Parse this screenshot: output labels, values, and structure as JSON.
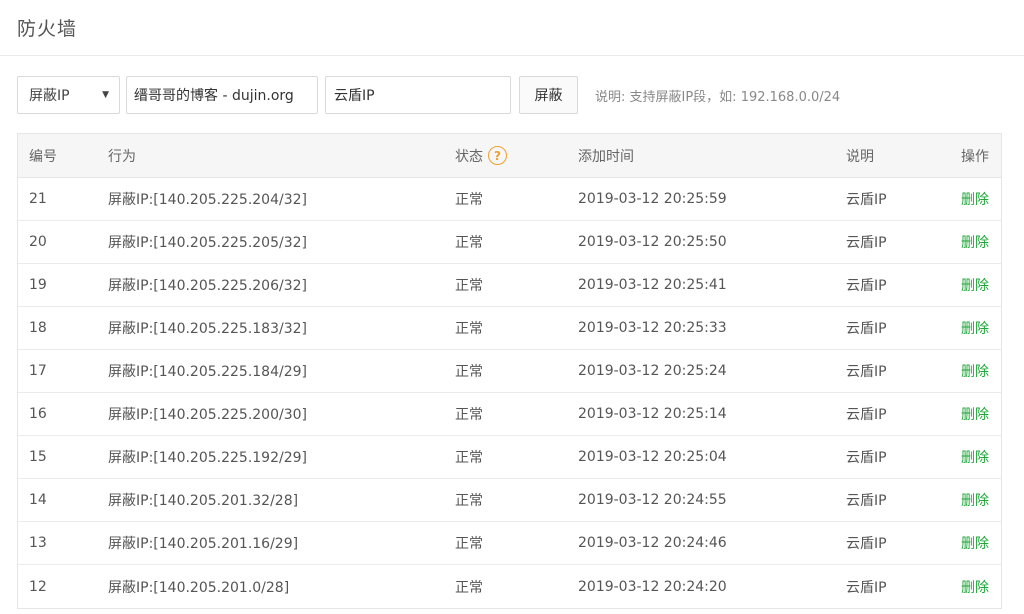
{
  "page": {
    "title": "防火墙"
  },
  "toolbar": {
    "select_value": "屏蔽IP",
    "site_value": "缙哥哥的博客 - dujin.org",
    "desc_value": "云盾IP",
    "block_label": "屏蔽",
    "hint": "说明: 支持屏蔽IP段，如: 192.168.0.0/24"
  },
  "table": {
    "headers": {
      "id": "编号",
      "action": "行为",
      "status": "状态",
      "time": "添加时间",
      "note": "说明",
      "op": "操作"
    },
    "rows": [
      {
        "id": "21",
        "action": "屏蔽IP:[140.205.225.204/32]",
        "status": "正常",
        "time": "2019-03-12 20:25:59",
        "note": "云盾IP",
        "op": "删除"
      },
      {
        "id": "20",
        "action": "屏蔽IP:[140.205.225.205/32]",
        "status": "正常",
        "time": "2019-03-12 20:25:50",
        "note": "云盾IP",
        "op": "删除"
      },
      {
        "id": "19",
        "action": "屏蔽IP:[140.205.225.206/32]",
        "status": "正常",
        "time": "2019-03-12 20:25:41",
        "note": "云盾IP",
        "op": "删除"
      },
      {
        "id": "18",
        "action": "屏蔽IP:[140.205.225.183/32]",
        "status": "正常",
        "time": "2019-03-12 20:25:33",
        "note": "云盾IP",
        "op": "删除"
      },
      {
        "id": "17",
        "action": "屏蔽IP:[140.205.225.184/29]",
        "status": "正常",
        "time": "2019-03-12 20:25:24",
        "note": "云盾IP",
        "op": "删除"
      },
      {
        "id": "16",
        "action": "屏蔽IP:[140.205.225.200/30]",
        "status": "正常",
        "time": "2019-03-12 20:25:14",
        "note": "云盾IP",
        "op": "删除"
      },
      {
        "id": "15",
        "action": "屏蔽IP:[140.205.225.192/29]",
        "status": "正常",
        "time": "2019-03-12 20:25:04",
        "note": "云盾IP",
        "op": "删除"
      },
      {
        "id": "14",
        "action": "屏蔽IP:[140.205.201.32/28]",
        "status": "正常",
        "time": "2019-03-12 20:24:55",
        "note": "云盾IP",
        "op": "删除"
      },
      {
        "id": "13",
        "action": "屏蔽IP:[140.205.201.16/29]",
        "status": "正常",
        "time": "2019-03-12 20:24:46",
        "note": "云盾IP",
        "op": "删除"
      },
      {
        "id": "12",
        "action": "屏蔽IP:[140.205.201.0/28]",
        "status": "正常",
        "time": "2019-03-12 20:24:20",
        "note": "云盾IP",
        "op": "删除"
      }
    ]
  },
  "icons": {
    "help": "question-circle-icon",
    "caret": "caret-down-icon"
  },
  "colors": {
    "accent_green": "#20a53a",
    "help_orange": "#f0a030"
  }
}
